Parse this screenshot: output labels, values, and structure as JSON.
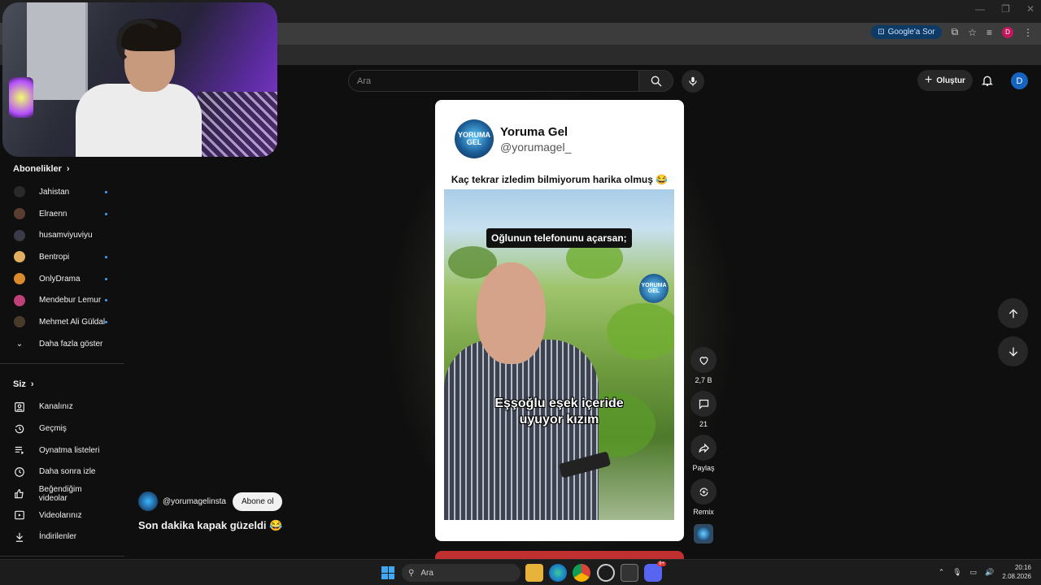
{
  "browser": {
    "google_ask": "Google'a Sor",
    "profile_letter": "D"
  },
  "header": {
    "search_placeholder": "Ara",
    "create_label": "Oluştur",
    "avatar_letter": "D"
  },
  "sidebar": {
    "subscriptions_title": "Abonelikler",
    "channels": [
      {
        "name": "Jahistan",
        "color": "#2a2a2a",
        "dot": true
      },
      {
        "name": "Elraenn",
        "color": "#5a3d30",
        "dot": true
      },
      {
        "name": "husamviyuviyu",
        "color": "#3a3a48",
        "dot": false
      },
      {
        "name": "Bentropi",
        "color": "#e0b060",
        "dot": true
      },
      {
        "name": "OnlyDrama",
        "color": "#d98a2b",
        "dot": true
      },
      {
        "name": "Mendebur Lemur",
        "color": "#c0407a",
        "dot": true
      },
      {
        "name": "Mehmet Ali Güldal",
        "color": "#4a3a2a",
        "dot": true
      }
    ],
    "show_more": "Daha fazla göster",
    "you_title": "Siz",
    "you_items": [
      {
        "label": "Kanalınız",
        "icon": "account-box-icon"
      },
      {
        "label": "Geçmiş",
        "icon": "history-icon"
      },
      {
        "label": "Oynatma listeleri",
        "icon": "playlists-icon"
      },
      {
        "label": "Daha sonra izle",
        "icon": "clock-icon"
      },
      {
        "label": "Beğendiğim videolar",
        "icon": "thumbs-up-icon"
      },
      {
        "label": "Videolarınız",
        "icon": "your-videos-icon"
      },
      {
        "label": "İndirilenler",
        "icon": "download-icon"
      }
    ]
  },
  "short": {
    "tweet_name": "Yoruma Gel",
    "tweet_handle": "@yorumagel_",
    "tweet_text": "Kaç tekrar izledim bilmiyorum harika olmuş 😂",
    "logo_text": "YORUMA GEL",
    "caption_top": "Oğlunun telefonunu açarsan;",
    "caption_mid_1": "Eşşoğlu eşek içeride",
    "caption_mid_2": "uyuyor kızım",
    "channel_handle": "@yorumagelinsta",
    "subscribe_label": "Abone ol",
    "title": "Son dakika kapak güzeldi 😂",
    "likes": "2,7 B",
    "comments": "21",
    "share_label": "Paylaş",
    "remix_label": "Remix"
  },
  "taskbar": {
    "search_label": "Ara",
    "time": "20:16",
    "date": "2.08.2026",
    "discord_badge": "9+"
  }
}
